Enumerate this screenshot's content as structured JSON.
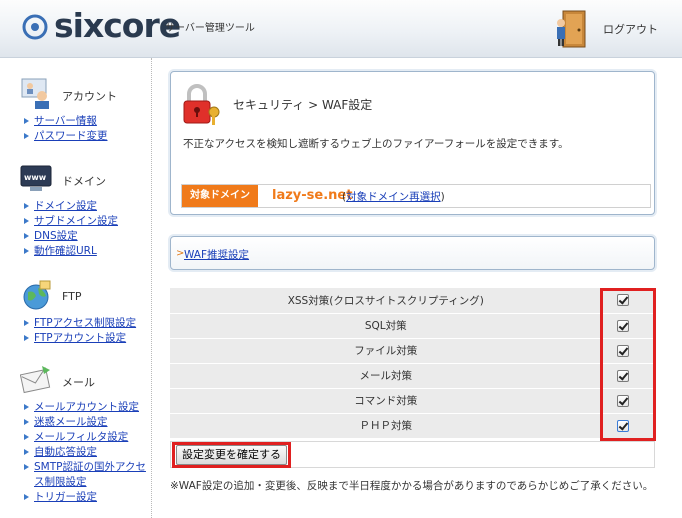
{
  "header": {
    "logo_text": "sixcore",
    "logo_sub": "サーバー管理ツール",
    "logout_label": "ログアウト"
  },
  "sidebar": {
    "sections": [
      {
        "title": "アカウント",
        "icon": "account-icon",
        "items": [
          "サーバー情報",
          "パスワード変更"
        ]
      },
      {
        "title": "ドメイン",
        "icon": "domain-www-icon",
        "items": [
          "ドメイン設定",
          "サブドメイン設定",
          "DNS設定",
          "動作確認URL"
        ]
      },
      {
        "title": "FTP",
        "icon": "ftp-globe-icon",
        "items": [
          "FTPアクセス制限設定",
          "FTPアカウント設定"
        ]
      },
      {
        "title": "メール",
        "icon": "mail-envelope-icon",
        "items": [
          "メールアカウント設定",
          "迷惑メール設定",
          "メールフィルタ設定",
          "自動応答設定",
          "SMTP認証の国外アクセス制限設定",
          "トリガー設定"
        ]
      }
    ]
  },
  "main": {
    "page_title": "セキュリティ > WAF設定",
    "description": "不正なアクセスを検知し遮断するウェブ上のファイアーフォールを設定できます。",
    "domain_badge": "対象ドメイン",
    "domain_name": "lazy-se.net",
    "domain_paren_open": " (",
    "domain_reselect": "対象ドメイン再選択",
    "domain_paren_close": ")",
    "waf_recommend_link": "WAF推奨設定",
    "waf_rows": [
      {
        "label": "XSS対策(クロスサイトスクリプティング)",
        "checked": true
      },
      {
        "label": "SQL対策",
        "checked": true
      },
      {
        "label": "ファイル対策",
        "checked": true
      },
      {
        "label": "メール対策",
        "checked": true
      },
      {
        "label": "コマンド対策",
        "checked": true
      },
      {
        "label": "ＰＨＰ対策",
        "checked": true
      }
    ],
    "submit_label": "設定変更を確定する",
    "note": "※WAF設定の追加・変更後、反映まで半日程度かかる場合がありますのであらかじめご了承ください。"
  },
  "colors": {
    "accent_orange": "#f07a1a",
    "link_blue": "#1a3fb8",
    "highlight_red": "#e02020"
  }
}
